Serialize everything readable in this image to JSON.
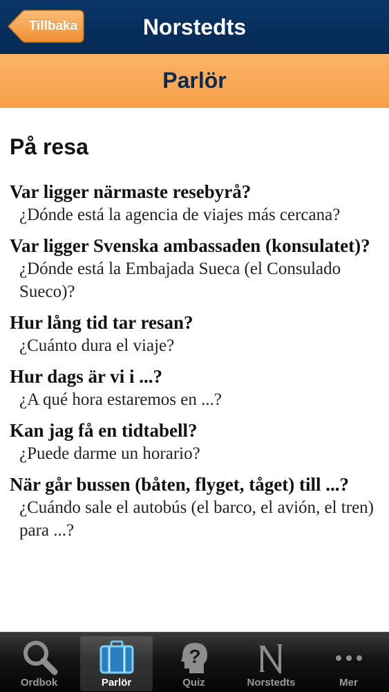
{
  "navbar": {
    "back_label": "Tillbaka",
    "title": "Norstedts"
  },
  "section": {
    "title": "Parlör"
  },
  "content": {
    "heading": "På resa",
    "phrases": [
      {
        "sv": "Var ligger närmaste resebyrå?",
        "es": "¿Dónde está la agencia de viajes más cercana?"
      },
      {
        "sv": "Var ligger Svenska ambassaden (konsulatet)?",
        "es": "¿Dónde está la Embajada Sueca (el Consulado Sueco)?"
      },
      {
        "sv": "Hur lång tid tar resan?",
        "es": "¿Cuánto dura el viaje?"
      },
      {
        "sv": "Hur dags är vi i ...?",
        "es": "¿A qué hora estaremos en ...?"
      },
      {
        "sv": "Kan jag få en tidtabell?",
        "es": "¿Puede darme un horario?"
      },
      {
        "sv": "När går bussen (båten, flyget, tåget) till ...?",
        "es": "¿Cuándo sale el autobús (el barco, el avión, el tren) para ...?"
      }
    ]
  },
  "tabbar": {
    "selected": "Parlör",
    "tabs": [
      {
        "label": "Ordbok",
        "icon": "magnifier-icon"
      },
      {
        "label": "Parlör",
        "icon": "suitcase-icon"
      },
      {
        "label": "Quiz",
        "icon": "question-head-icon"
      },
      {
        "label": "Norstedts",
        "icon": "norstedts-n-logo-icon"
      },
      {
        "label": "Mer",
        "icon": "more-dots-icon"
      }
    ]
  },
  "colors": {
    "navbar_bg": "#07305e",
    "back_button": "#f7a54e",
    "section_bar": "#f8a853",
    "section_text": "#0b2a4e",
    "tabbar_bg": "#111111",
    "tab_selected_icon": "#6fc3f0"
  }
}
